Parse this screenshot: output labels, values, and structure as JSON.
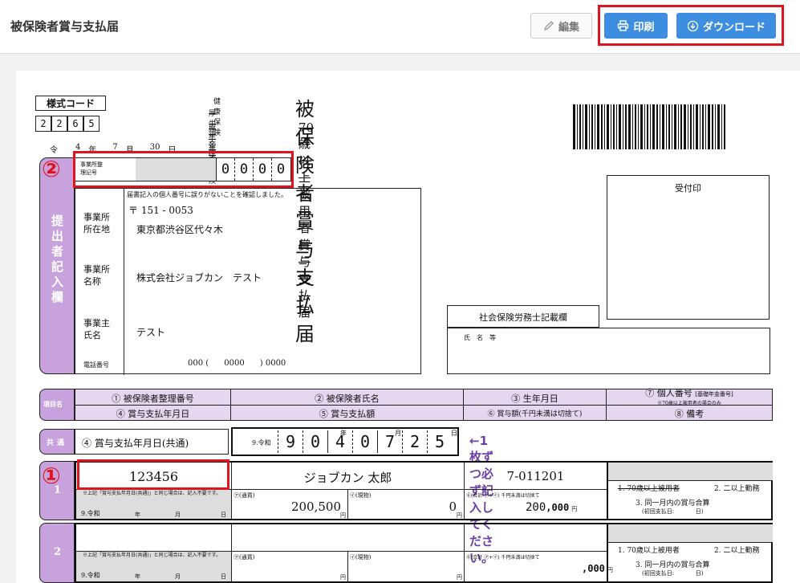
{
  "header": {
    "title": "被保険者賞与支払届",
    "edit_label": "編集",
    "print_label": "印刷",
    "download_label": "ダウンロード"
  },
  "form": {
    "code_label": "様式コード",
    "code_digits": [
      "2",
      "2",
      "6",
      "5"
    ],
    "ins_1": "健康保険",
    "ins_2": "厚生年金保険",
    "ins_3": "厚生年金保険",
    "main_title": "被保険者賞与支払届",
    "sub_title": "70歳以上被用者賞与支払届",
    "date_line": {
      "era": "令和",
      "year": "4",
      "year_u": "年",
      "month": "7",
      "month_u": "月",
      "day": "30",
      "day_u": "日提出"
    },
    "office_code_label": "事業所整理記号",
    "office_code": [
      "0",
      "0",
      "0",
      "0"
    ],
    "submitter_label": "提出者記入欄",
    "confirm_note": "届書記入の個人番号に誤りがないことを確認しました。",
    "address_label": "事業所所在地",
    "postal": "〒 151 - 0053",
    "address": "東京都渋谷区代々木",
    "name_label": "事業所名称",
    "company_name": "株式会社ジョブカン　テスト",
    "owner_label": "事業主氏名",
    "owner_name": "テスト",
    "phone_label": "電話番号",
    "phone": "000 (      0000      ) 0000",
    "receipt_label": "受付印",
    "sharoshi_label": "社会保険労務士記載欄",
    "sharoshi_name": "氏　名　等",
    "item_label": "項目名",
    "headers": {
      "h1": "① 被保険者整理番号",
      "h2": "② 被保険者氏名",
      "h3": "③ 生年月日",
      "h7": "⑦ 個人番号",
      "h7note": "[基礎年金番号]",
      "h7note2": "※70歳以上被用者の場合のみ",
      "h4": "④ 賞与支払年月日",
      "h5": "⑤ 賞与支払額",
      "h6": "⑥ 賞与額(千円未満は切捨て)",
      "h8": "⑧ 備考"
    },
    "common_label": "共通",
    "common_title": "④ 賞与支払年月日(共通)",
    "common_era": "9.令和",
    "common_digits": [
      "9",
      "0",
      "4",
      "0",
      "7",
      "2",
      "5"
    ],
    "common_units": [
      "年",
      "月",
      "日"
    ],
    "notice": "←1枚ずつ必ず記入してください。",
    "rows": [
      {
        "no": "1",
        "id": "123456",
        "name": "ジョブカン 太郎",
        "birth": "7-011201",
        "note4": "※上記「賞与支払年月日(共通)」と同じ場合は、記入不要です。",
        "era": "9.令和",
        "y": "年",
        "m": "月",
        "d": "日",
        "cash_label": "㋐(通貨)",
        "cash": "200,500",
        "kind_label": "㋑(現物)",
        "kind": "0",
        "yen": "円",
        "total_label": "⑥(合計 ㋐+㋑) 千円未満は切捨て",
        "total": "200",
        "total_tail": ",000",
        "remark1": "1. 70歳以上被用者",
        "remark2": "2. 二以上勤務",
        "remark3": "3. 同一月内の賞与合算",
        "remark4": "(初回支払日:            日)"
      },
      {
        "no": "2",
        "id": "",
        "name": "",
        "birth": "",
        "note4": "※上記「賞与支払年月日(共通)」と同じ場合は、記入不要です。",
        "era": "9.令和",
        "y": "年",
        "m": "月",
        "d": "日",
        "cash_label": "㋐(通貨)",
        "cash": "",
        "kind_label": "㋑(現物)",
        "kind": "",
        "yen": "円",
        "total_label": "⑥(合計 ㋐+㋑) 千円未満は切捨て",
        "total": "",
        "total_tail": ",000",
        "remark1": "1. 70歳以上被用者",
        "remark2": "2. 二以上勤務",
        "remark3": "3. 同一月内の賞与合算",
        "remark4": "(初回支払日:            日)"
      }
    ],
    "marker1": "①",
    "marker2": "②"
  },
  "colors": {
    "accent": "#3d8ee0",
    "highlight": "#e0141e",
    "form_pink": "#c8a2dc",
    "notice": "#6b3fa8"
  }
}
